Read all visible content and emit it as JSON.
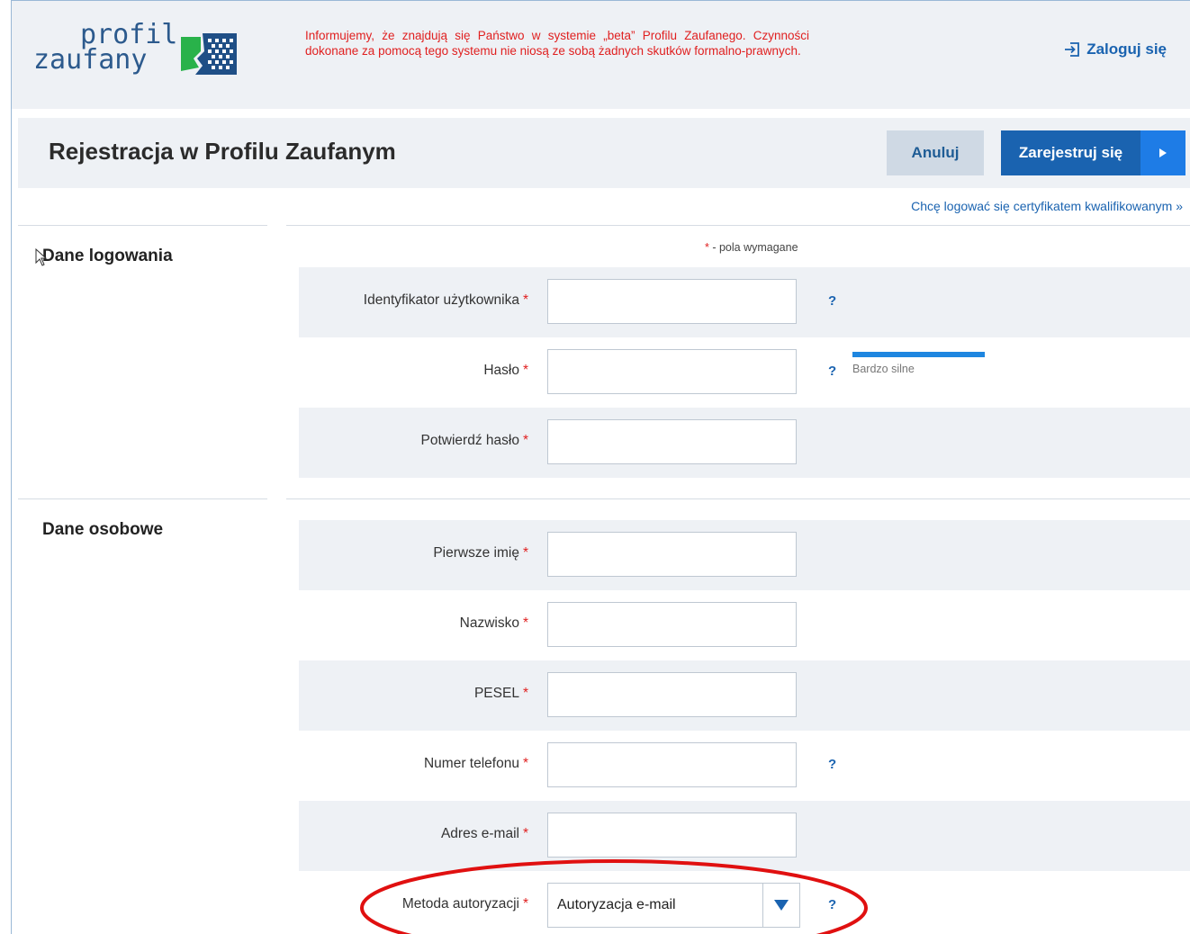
{
  "colors": {
    "accent": "#1a63b0",
    "header_bg": "#eef1f5",
    "notice": "#e02020",
    "strength_bar": "#1e86e0",
    "annotation": "#e01010"
  },
  "header": {
    "logo": {
      "line1": "profil",
      "line2": "zaufany"
    },
    "notice": "Informujemy, że znajdują się Państwo w systemie „beta” Profilu Zaufanego. Czynności dokonane za pomocą tego systemu nie niosą ze sobą żadnych skutków formalno-prawnych.",
    "login_label": "Zaloguj się",
    "login_icon": "login-icon"
  },
  "titlebar": {
    "title": "Rejestracja w Profilu Zaufanym",
    "cancel_label": "Anuluj",
    "register_label": "Zarejestruj się"
  },
  "cert_link": "Chcę logować się certyfikatem kwalifikowanym »",
  "required_note": {
    "star": "*",
    "text": " - pola wymagane"
  },
  "login_section": {
    "title": "Dane logowania",
    "fields": [
      {
        "label": "Identyfikator użytkownika",
        "value": "",
        "help": "?"
      },
      {
        "label": "Hasło",
        "value": "",
        "help": "?",
        "strength": "Bardzo silne",
        "strength_level": 1.0
      },
      {
        "label": "Potwierdź hasło",
        "value": ""
      }
    ]
  },
  "personal_section": {
    "title": "Dane osobowe",
    "fields": [
      {
        "label": "Pierwsze imię",
        "value": ""
      },
      {
        "label": "Nazwisko",
        "value": ""
      },
      {
        "label": "PESEL",
        "value": ""
      },
      {
        "label": "Numer telefonu",
        "value": "",
        "help": "?"
      },
      {
        "label": "Adres e-mail",
        "value": ""
      },
      {
        "label": "Metoda autoryzacji",
        "selected": "Autoryzacja e-mail",
        "help": "?"
      }
    ]
  },
  "star": "*"
}
